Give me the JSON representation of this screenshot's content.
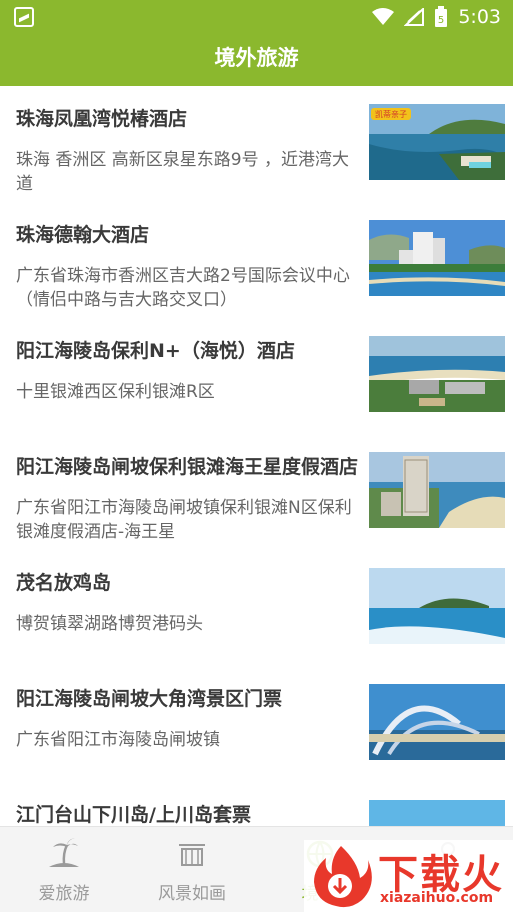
{
  "status_bar": {
    "time": "5:03",
    "battery_level": "5"
  },
  "header": {
    "title": "境外旅游"
  },
  "list": [
    {
      "title": "珠海凤凰湾悦椿酒店",
      "address": "珠海 香洲区 高新区泉星东路9号 ，近港湾大道",
      "image_badge": "凯蒂亲子"
    },
    {
      "title": "珠海德翰大酒店",
      "address": "广东省珠海市香洲区吉大路2号国际会议中心（情侣中路与吉大路交叉口）"
    },
    {
      "title": "阳江海陵岛保利N+（海悦）酒店",
      "address": "十里银滩西区保利银滩R区"
    },
    {
      "title": "阳江海陵岛闸坡保利银滩海王星度假酒店",
      "address": "广东省阳江市海陵岛闸坡镇保利银滩N区保利银滩度假酒店-海王星"
    },
    {
      "title": "茂名放鸡岛",
      "address": "博贺镇翠湖路博贺港码头"
    },
    {
      "title": "阳江海陵岛闸坡大角湾景区门票",
      "address": "广东省阳江市海陵岛闸坡镇"
    },
    {
      "title": "江门台山下川岛/上川岛套票",
      "address": ""
    }
  ],
  "bottom_nav": [
    {
      "label": "爱旅游",
      "icon": "palm-island-icon"
    },
    {
      "label": "风景如画",
      "icon": "scenery-icon"
    },
    {
      "label": "境",
      "icon": "globe-icon",
      "active": true
    },
    {
      "label": "",
      "icon": "profile-icon"
    }
  ],
  "watermark": {
    "text": "下载火",
    "url": "xiazaihuo.com"
  },
  "colors": {
    "accent": "#8bb82e",
    "watermark": "#e8382b"
  }
}
